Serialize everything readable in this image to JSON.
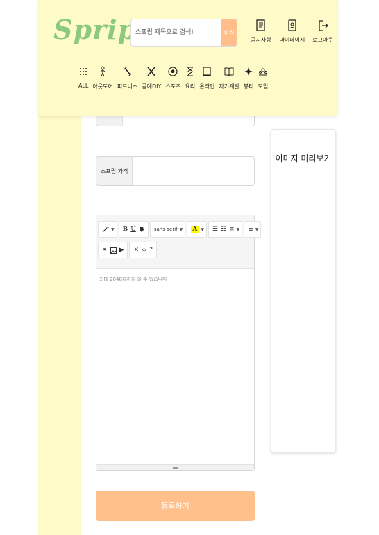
{
  "header": {
    "logo": "Sprip",
    "search": {
      "placeholder": "스프립 제목으로 검색!",
      "button": "입력"
    },
    "links": [
      {
        "label": "공지사항",
        "icon": "notice-icon"
      },
      {
        "label": "마이페이지",
        "icon": "mypage-icon"
      },
      {
        "label": "로그아웃",
        "icon": "logout-icon"
      }
    ],
    "categories": [
      {
        "label": "ALL",
        "icon": "grid-icon"
      },
      {
        "label": "아웃도어",
        "icon": "outdoor-icon"
      },
      {
        "label": "피트니스",
        "icon": "fitness-icon"
      },
      {
        "label": "공예DIY",
        "icon": "craft-icon"
      },
      {
        "label": "스포츠",
        "icon": "soccer-icon"
      },
      {
        "label": "요리",
        "icon": "cooking-icon"
      },
      {
        "label": "온라인",
        "icon": "online-icon"
      },
      {
        "label": "자기계발",
        "icon": "book-icon"
      },
      {
        "label": "뷰티",
        "icon": "sparkle-icon"
      },
      {
        "label": "모임",
        "icon": "group-icon"
      }
    ]
  },
  "form": {
    "price_label": "스프립 가격",
    "editor_placeholder": "최대 2048자까지 쓸 수 있습니다",
    "submit": "등록하기",
    "toolbar": {
      "font": "sans-serif",
      "highlight": "A",
      "bold": "B",
      "underline": "U",
      "help": "?"
    }
  },
  "preview": {
    "title": "이미지 미리보기"
  },
  "colors": {
    "header_bg": "#fffbc9",
    "logo": "#8cc97f",
    "accent": "#ffc08c"
  }
}
